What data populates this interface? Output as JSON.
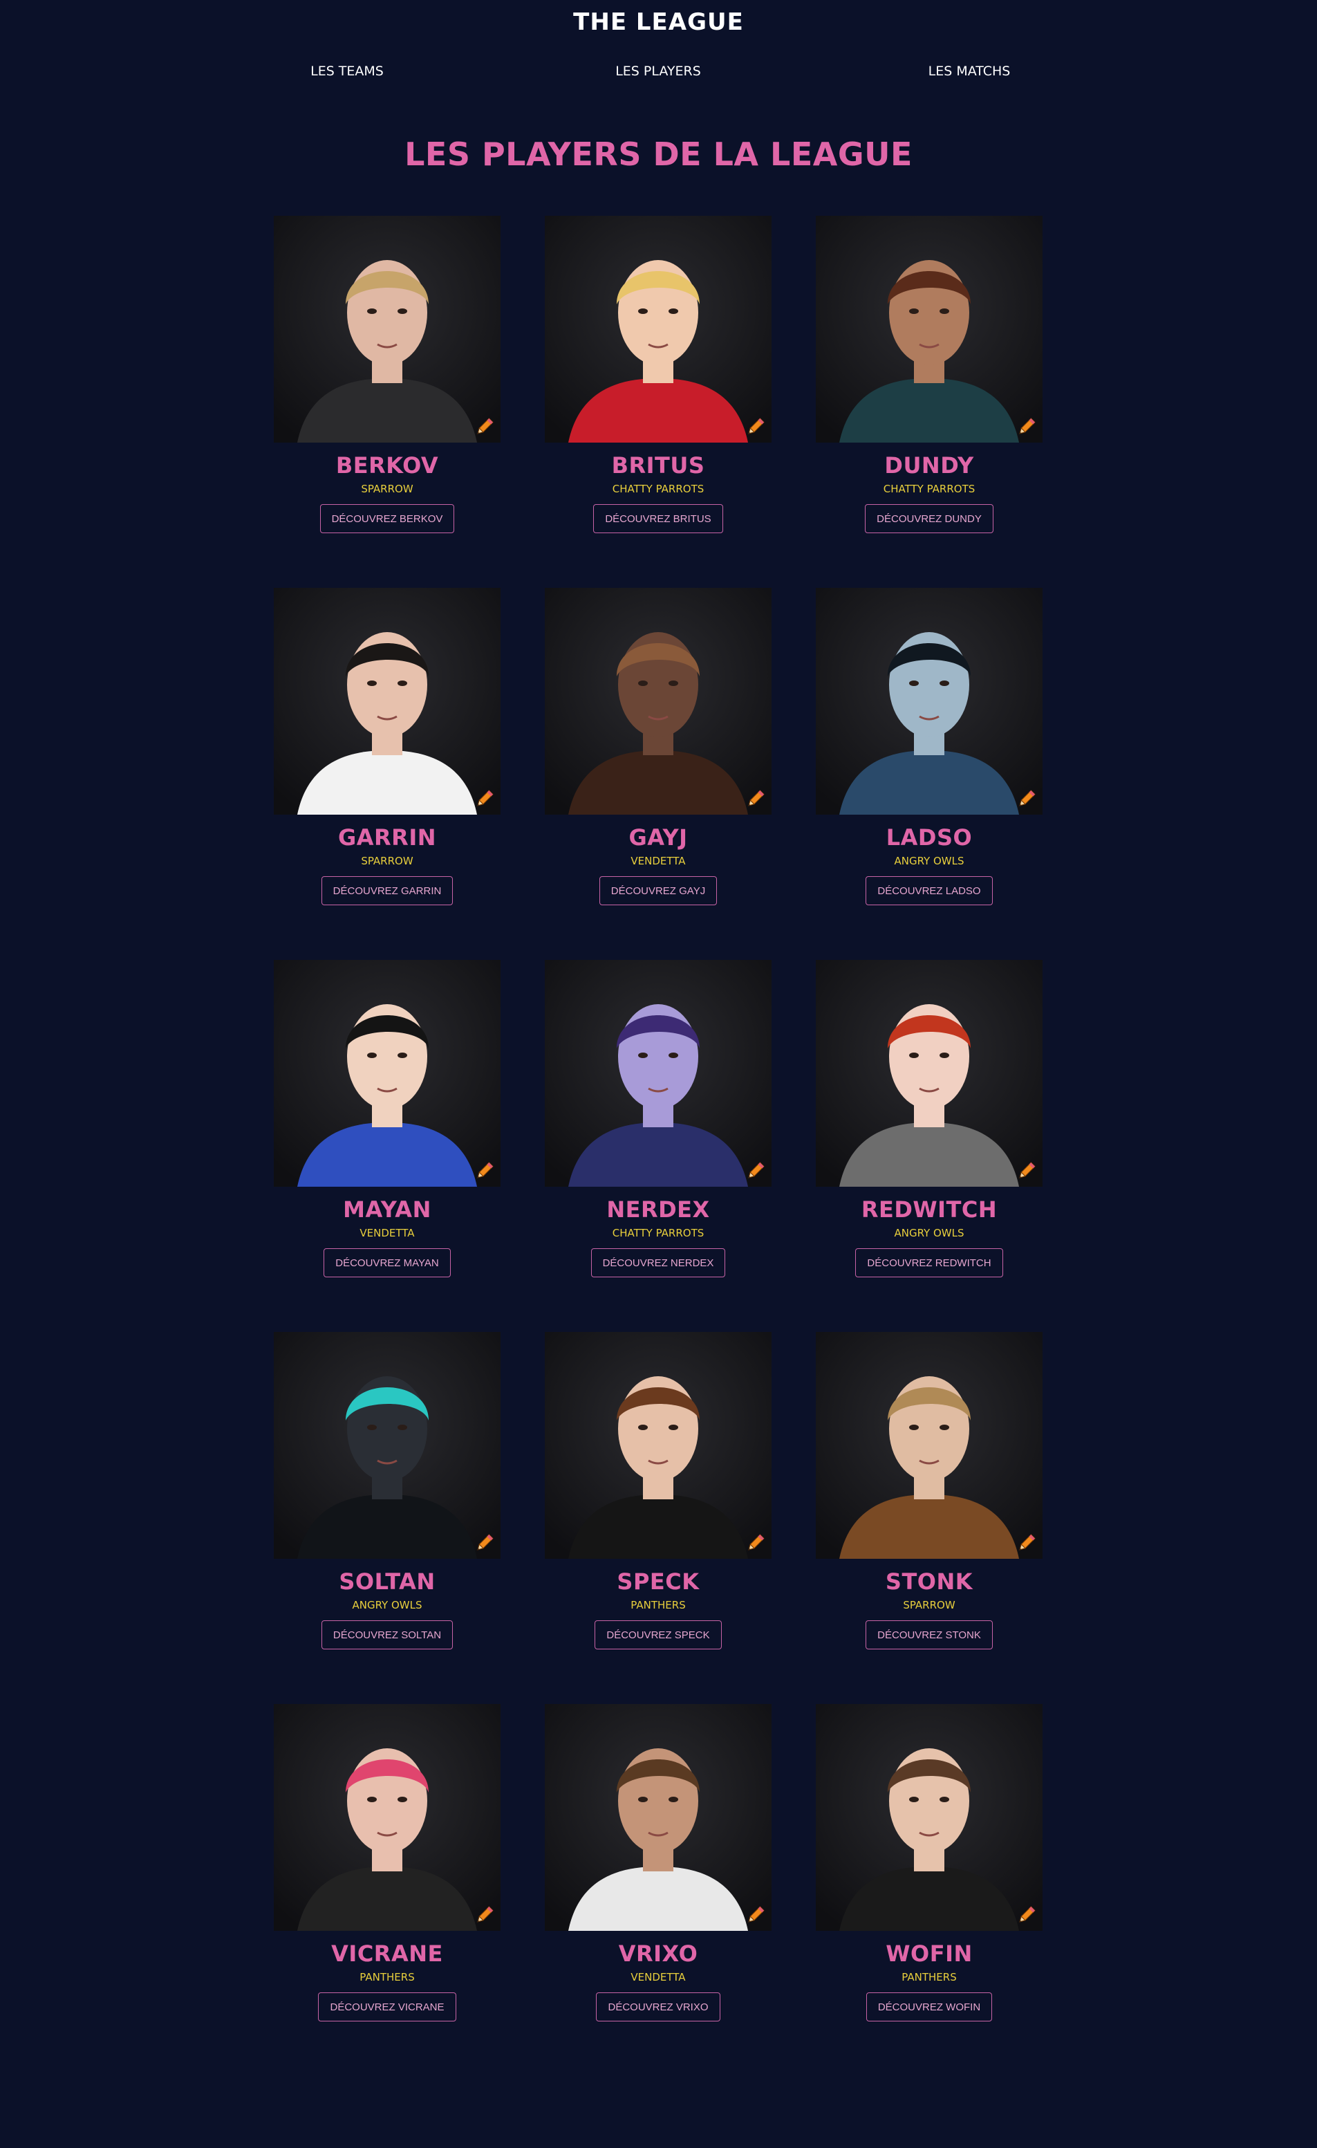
{
  "site": {
    "title": "THE LEAGUE"
  },
  "nav": {
    "teams": "LES TEAMS",
    "players": "LES PLAYERS",
    "matchs": "LES MATCHS"
  },
  "page": {
    "heading": "LES PLAYERS DE LA LEAGUE"
  },
  "colors": {
    "background": "#0b1129",
    "accent_pink": "#e066a8",
    "team_yellow": "#e8cf3c"
  },
  "players": [
    {
      "name": "BERKOV",
      "team": "SPARROW",
      "button": "DÉCOUVREZ BERKOV",
      "edit_icon": "pencil-icon"
    },
    {
      "name": "BRITUS",
      "team": "CHATTY PARROTS",
      "button": "DÉCOUVREZ BRITUS",
      "edit_icon": "pencil-icon"
    },
    {
      "name": "DUNDY",
      "team": "CHATTY PARROTS",
      "button": "DÉCOUVREZ DUNDY",
      "edit_icon": "pencil-icon"
    },
    {
      "name": "GARRIN",
      "team": "SPARROW",
      "button": "DÉCOUVREZ GARRIN",
      "edit_icon": "pencil-icon"
    },
    {
      "name": "GAYJ",
      "team": "VENDETTA",
      "button": "DÉCOUVREZ GAYJ",
      "edit_icon": "pencil-icon"
    },
    {
      "name": "LADSO",
      "team": "ANGRY OWLS",
      "button": "DÉCOUVREZ LADSO",
      "edit_icon": "pencil-icon"
    },
    {
      "name": "MAYAN",
      "team": "VENDETTA",
      "button": "DÉCOUVREZ MAYAN",
      "edit_icon": "pencil-icon"
    },
    {
      "name": "NERDEX",
      "team": "CHATTY PARROTS",
      "button": "DÉCOUVREZ NERDEX",
      "edit_icon": "pencil-icon"
    },
    {
      "name": "REDWITCH",
      "team": "ANGRY OWLS",
      "button": "DÉCOUVREZ REDWITCH",
      "edit_icon": "pencil-icon"
    },
    {
      "name": "SOLTAN",
      "team": "ANGRY OWLS",
      "button": "DÉCOUVREZ SOLTAN",
      "edit_icon": "pencil-icon"
    },
    {
      "name": "SPECK",
      "team": "PANTHERS",
      "button": "DÉCOUVREZ SPECK",
      "edit_icon": "pencil-icon"
    },
    {
      "name": "STONK",
      "team": "SPARROW",
      "button": "DÉCOUVREZ STONK",
      "edit_icon": "pencil-icon"
    },
    {
      "name": "VICRANE",
      "team": "PANTHERS",
      "button": "DÉCOUVREZ VICRANE",
      "edit_icon": "pencil-icon"
    },
    {
      "name": "VRIXO",
      "team": "VENDETTA",
      "button": "DÉCOUVREZ VRIXO",
      "edit_icon": "pencil-icon"
    },
    {
      "name": "WOFIN",
      "team": "PANTHERS",
      "button": "DÉCOUVREZ WOFIN",
      "edit_icon": "pencil-icon"
    }
  ]
}
